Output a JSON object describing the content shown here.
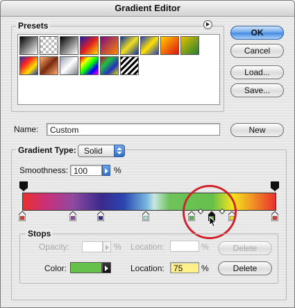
{
  "window": {
    "title": "Gradient Editor"
  },
  "presets": {
    "label": "Presets",
    "swatches": [
      "linear-gradient(135deg,#000,#fff)",
      "repeating-conic-gradient(#bbb 0 25%,#fff 0 50%) 0 0/8px 8px",
      "linear-gradient(135deg,#000,#fff)",
      "linear-gradient(135deg,#1a1ab0,#e02020,#ffe000)",
      "linear-gradient(135deg,#7a0a80,#ff8800)",
      "linear-gradient(135deg,#1030a0,#f0e020,#1030a0)",
      "linear-gradient(135deg,#2040c0,#ffe000,#2040c0)",
      "linear-gradient(135deg,#ffd000,#e01010)",
      "linear-gradient(135deg,#e8c000,#208030)",
      "linear-gradient(135deg,#2030c0,#ff2020,#ffe000,#2030c0)",
      "linear-gradient(135deg,#ffb070,#7a2a10,#ffb070)",
      "linear-gradient(135deg,#9aa0b0,#ffffff,#7a7f8c)",
      "linear-gradient(135deg,#ff0000,#ffff00,#00ff00,#0000ff,#ff00ff)",
      "linear-gradient(135deg,#c01030,#20c040,#2030c0,#e0e000)",
      "repeating-linear-gradient(135deg,#000 0 3px,#fff 3px 6px)"
    ]
  },
  "buttons": {
    "ok": "OK",
    "cancel": "Cancel",
    "load": "Load...",
    "save": "Save...",
    "new": "New",
    "delete1": "Delete",
    "delete2": "Delete"
  },
  "name": {
    "label": "Name:",
    "value": "Custom"
  },
  "gradient_type": {
    "label": "Gradient Type:",
    "value": "Solid"
  },
  "smoothness": {
    "label": "Smoothness:",
    "value": "100",
    "unit": "%"
  },
  "stops": {
    "label": "Stops",
    "opacity_label": "Opacity:",
    "opacity_unit": "%",
    "location1_label": "Location:",
    "location1_unit": "%",
    "color_label": "Color:",
    "color_value": "#66c04c",
    "location2_label": "Location:",
    "location2_value": "75",
    "location2_unit": "%"
  },
  "gradient": "linear-gradient(90deg,#e8302e 0%,#cc2f78 9%,#8e4aa0 20%,#3a2a8c 31%,#2a46b0 40%,#77b6df 49%,#c8e6e4 52%,#6ec25a 58%,#66c04c 75%,#f5e61c 83%,#f19224 91%,#e8302e 100%)",
  "color_stops": [
    {
      "pos": 0,
      "color": "#e03a2c"
    },
    {
      "pos": 20,
      "color": "#8e4aa0"
    },
    {
      "pos": 31,
      "color": "#2a2a90"
    },
    {
      "pos": 49,
      "color": "#b8e0e0"
    },
    {
      "pos": 67,
      "color": "#5cb848"
    },
    {
      "pos": 75,
      "color": "#66c04c",
      "selected": true
    },
    {
      "pos": 83,
      "color": "#f0e020"
    },
    {
      "pos": 100,
      "color": "#e03a2c"
    }
  ],
  "colors": {
    "highlight_circle": "#d0202a",
    "selection_field": "#fff08a"
  }
}
